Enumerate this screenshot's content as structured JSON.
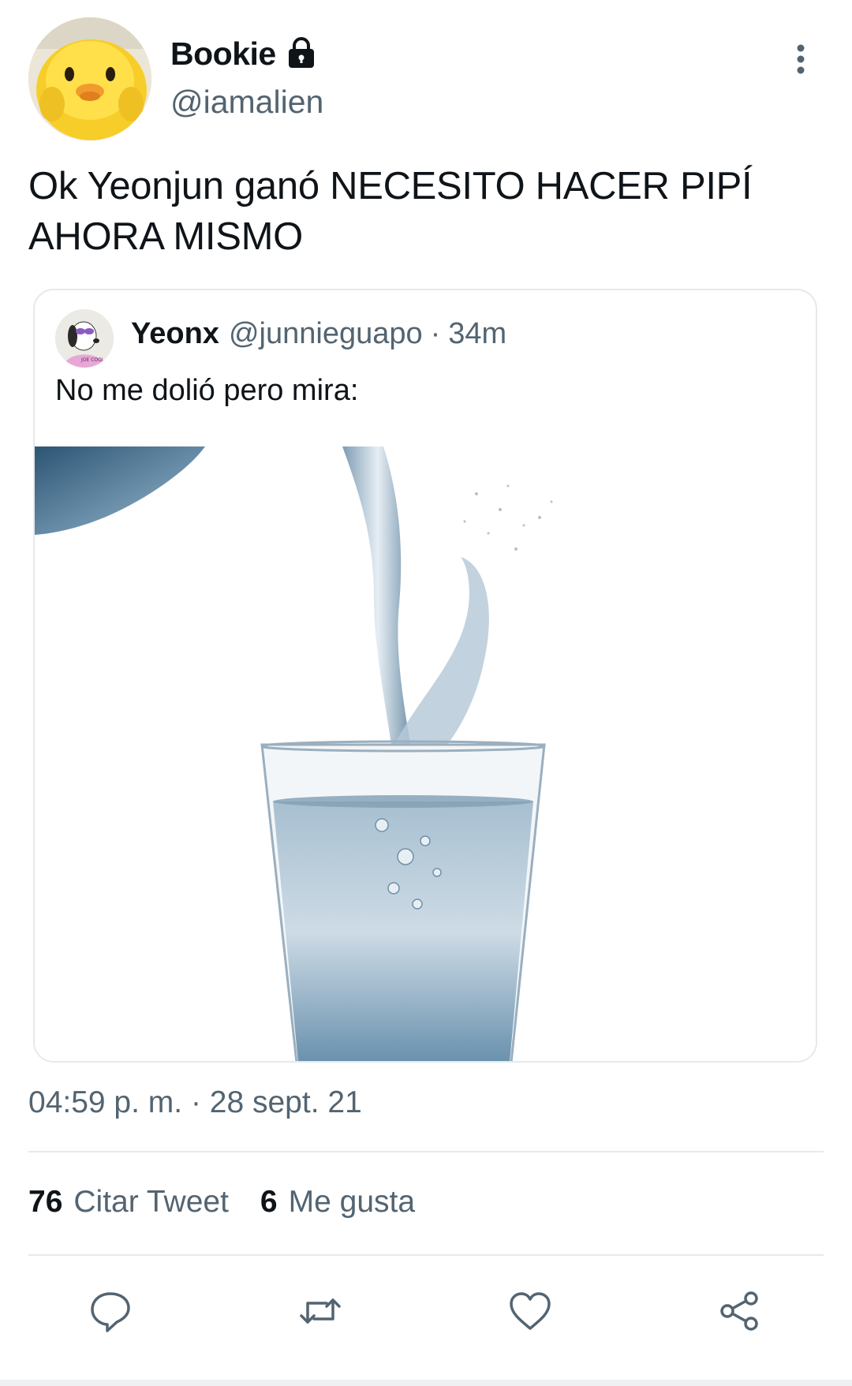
{
  "tweet": {
    "author": {
      "display_name": "Bookie",
      "handle": "@iamalien",
      "protected_icon": "lock-icon"
    },
    "text": "Ok Yeonjun ganó NECESITO HACER PIPÍ\nAHORA MISMO",
    "timestamp": "04:59 p. m. · 28 sept. 21",
    "stats": [
      {
        "count": "76",
        "label": "Citar Tweet"
      },
      {
        "count": "6",
        "label": "Me gusta"
      }
    ],
    "actions": [
      "reply-icon",
      "retweet-icon",
      "like-icon",
      "share-icon"
    ]
  },
  "quoted_tweet": {
    "display_name": "Yeonx",
    "handle": "@junnieguapo",
    "separator": "·",
    "time": "34m",
    "text": "No me dolió pero mira:",
    "avatar_caption": "JOE COOL",
    "media": "glass of water being poured"
  },
  "colors": {
    "text_primary": "#0f1419",
    "text_secondary": "#536471",
    "border": "#e6e9ec",
    "icon": "#536471"
  }
}
